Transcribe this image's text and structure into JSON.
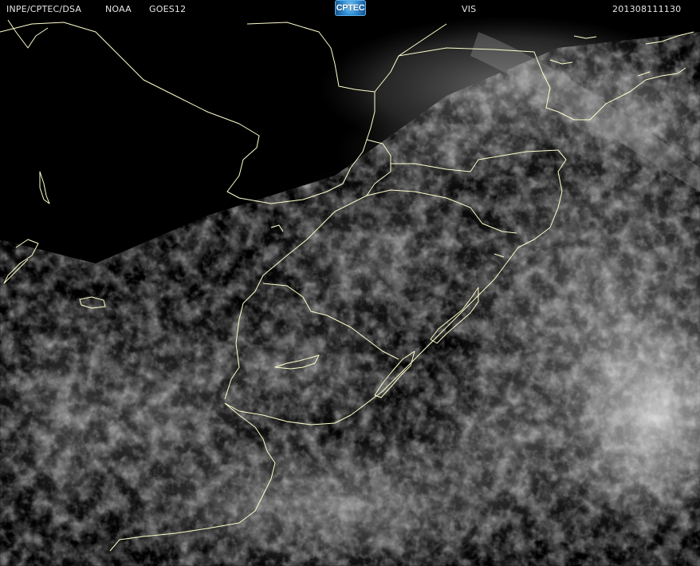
{
  "header": {
    "agency": "INPE/CPTEC/DSA",
    "source": "NOAA",
    "satellite": "GOES12",
    "logo_text": "CPTEC",
    "channel": "VIS",
    "timestamp": "201308111130"
  },
  "colors": {
    "background": "#000000",
    "header_text": "#e6e6e6",
    "coastline": "#ffffcc",
    "logo_blue": "#2f8fd6"
  },
  "icons": {
    "logo": "cptec-logo-icon"
  }
}
